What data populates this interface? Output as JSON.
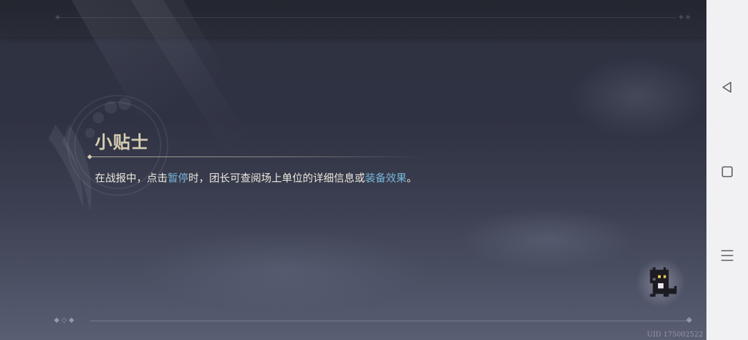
{
  "tip": {
    "title": "小贴士",
    "text_segments": [
      {
        "text": "在战报中，点击",
        "highlight": false
      },
      {
        "text": "暂停",
        "highlight": true
      },
      {
        "text": "时，团长可查阅场上单位的详细信息或",
        "highlight": false
      },
      {
        "text": "装备效果",
        "highlight": true
      },
      {
        "text": "。",
        "highlight": false
      }
    ]
  },
  "footer": {
    "uid": "UID 175002522"
  },
  "nav_bar": {
    "buttons": [
      {
        "name": "back-button",
        "icon": "triangle-back-icon"
      },
      {
        "name": "home-button",
        "icon": "square-home-icon"
      },
      {
        "name": "recents-button",
        "icon": "menu-lines-icon"
      }
    ]
  },
  "colors": {
    "title": "#d7cdb2",
    "body_text": "#ece8de",
    "highlight": "#77b6d9",
    "nav_bar_bg": "#f1f1f3"
  }
}
